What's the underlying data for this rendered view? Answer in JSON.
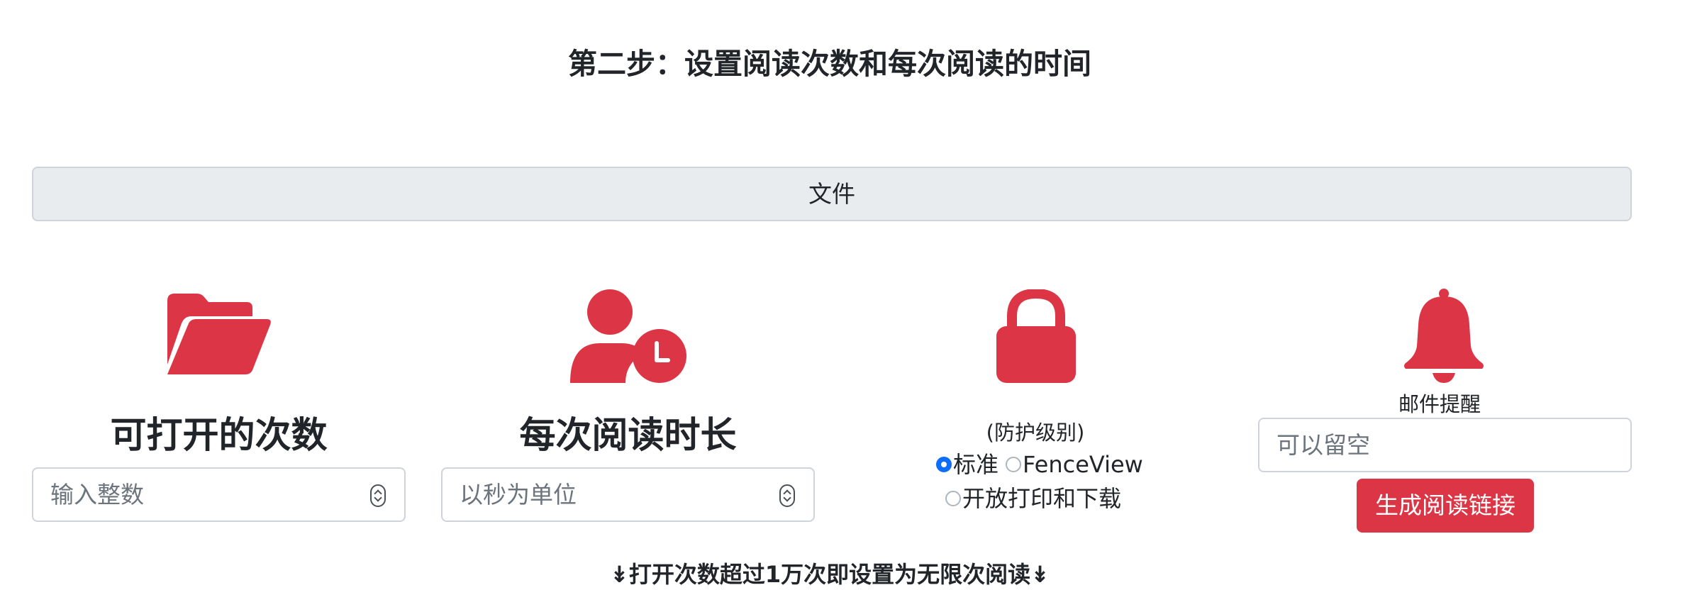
{
  "step": {
    "title": "第二步：设置阅读次数和每次阅读的时间"
  },
  "file": {
    "label": "文件"
  },
  "open_count": {
    "icon": "folder-open-icon",
    "label": "可打开的次数",
    "placeholder": "输入整数"
  },
  "read_duration": {
    "icon": "user-clock-icon",
    "label": "每次阅读时长",
    "placeholder": "以秒为单位"
  },
  "protection": {
    "icon": "lock-icon",
    "label": "(防护级别)",
    "options": [
      {
        "label": "标准",
        "checked": true
      },
      {
        "label": "FenceView",
        "checked": false
      },
      {
        "label": "开放打印和下载",
        "checked": false
      }
    ]
  },
  "email": {
    "icon": "bell-icon",
    "label": "邮件提醒",
    "placeholder": "可以留空"
  },
  "generate": {
    "label": "生成阅读链接"
  },
  "note": {
    "text": "↡打开次数超过1万次即设置为无限次阅读↡"
  },
  "colors": {
    "accent": "#dc3545",
    "radio": "#0d6efd",
    "button_bg": "#e9ecef"
  }
}
